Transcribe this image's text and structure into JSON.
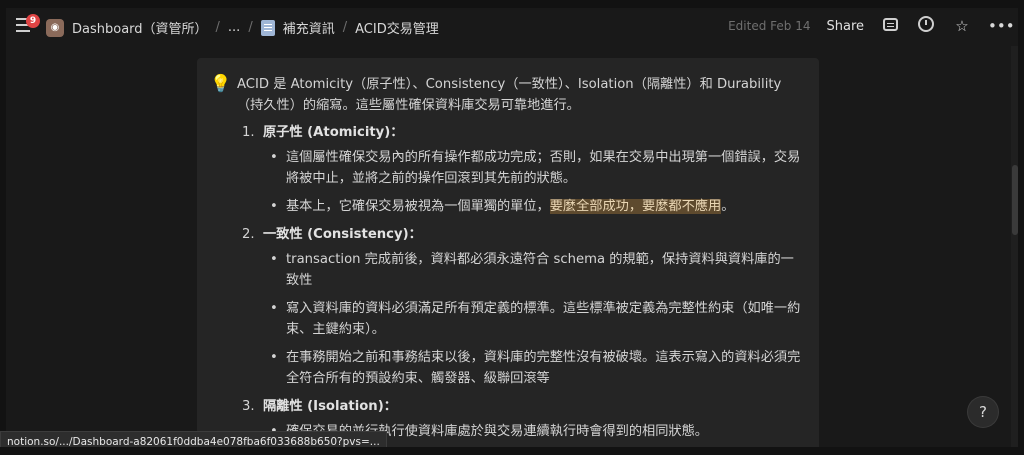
{
  "topbar": {
    "notification_count": "9",
    "breadcrumbs": {
      "workspace": "Dashboard（資管所）",
      "ellipsis": "...",
      "page": "補充資訊",
      "current": "ACID交易管理"
    },
    "edited": "Edited Feb 14",
    "share": "Share"
  },
  "callout": {
    "icon": "lightbulb-icon",
    "intro": "ACID 是 Atomicity（原子性）、Consistency（一致性）、Isolation（隔離性）和 Durability（持久性）的縮寫。這些屬性確保資料庫交易可靠地進行。",
    "sections": [
      {
        "num": "1.",
        "title": "原子性 (Atomicity)：",
        "bullets": [
          "這個屬性確保交易內的所有操作都成功完成；否則，如果在交易中出現第一個錯誤，交易將被中止，並將之前的操作回滾到其先前的狀態。"
        ],
        "bullet2_prefix": "基本上，它確保交易被視為一個單獨的單位，",
        "bullet2_highlight": "要麼全部成功，要麼都不應用",
        "bullet2_suffix": "。"
      },
      {
        "num": "2.",
        "title": "一致性 (Consistency)：",
        "bullets": [
          "transaction 完成前後，資料都必須永遠符合 schema 的規範，保持資料與資料庫的一致性",
          "寫入資料庫的資料必須滿足所有預定義的標準。這些標準被定義為完整性約束（如唯一約束、主鍵約束）。",
          "在事務開始之前和事務結束以後，資料庫的完整性沒有被破壞。這表示寫入的資料必須完全符合所有的預設約束、觸發器、級聯回滾等"
        ]
      },
      {
        "num": "3.",
        "title": "隔離性 (Isolation)：",
        "bullets": [
          "確保交易的並行執行使資料庫處於與交易連續執行時會得到的相同狀態。"
        ]
      }
    ]
  },
  "help": "?",
  "status_url": "notion.so/.../Dashboard-a82061f0ddba4e078fba6f033688b650?pvs=..."
}
